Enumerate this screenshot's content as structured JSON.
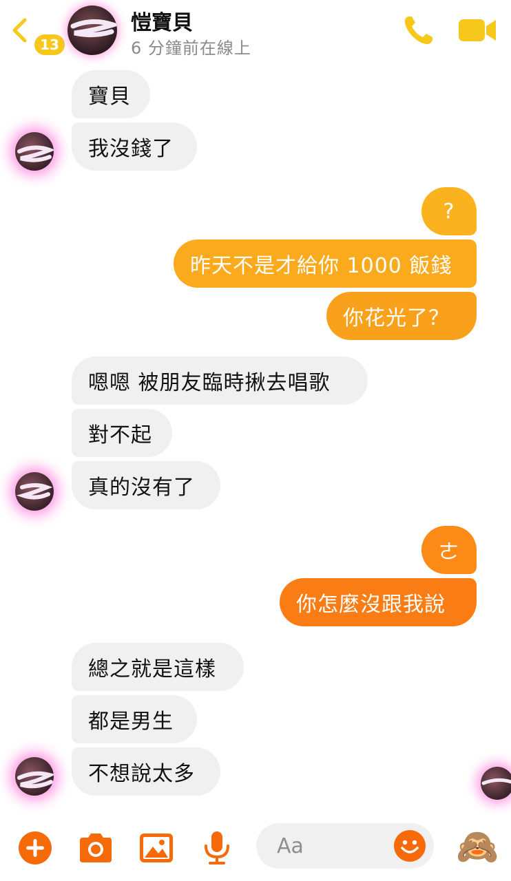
{
  "header": {
    "badge_count": "13",
    "contact_name": "愷寶貝",
    "status": "6 分鐘前在線上"
  },
  "messages": [
    {
      "from": "them",
      "text": "寶貝"
    },
    {
      "from": "them",
      "text": "我沒錢了"
    },
    {
      "from": "me",
      "text": "?"
    },
    {
      "from": "me",
      "text": "昨天不是才給你 1000 飯錢"
    },
    {
      "from": "me",
      "text": "你花光了？"
    },
    {
      "from": "them",
      "text": "嗯嗯 被朋友臨時揪去唱歌"
    },
    {
      "from": "them",
      "text": "對不起"
    },
    {
      "from": "them",
      "text": "真的沒有了"
    },
    {
      "from": "me",
      "text": "ㄜ"
    },
    {
      "from": "me",
      "text": "你怎麼沒跟我說"
    },
    {
      "from": "them",
      "text": "總之就是這樣"
    },
    {
      "from": "them",
      "text": "都是男生"
    },
    {
      "from": "them",
      "text": "不想說太多"
    }
  ],
  "composer": {
    "placeholder": "Aa",
    "quick_reaction": "🙈"
  },
  "colors": {
    "accent": "#f66a0a",
    "out_top": "#fbb21f",
    "out_bottom": "#fa7c14",
    "incoming_bubble": "#f0f0f0",
    "badge": "#f7c81c"
  }
}
